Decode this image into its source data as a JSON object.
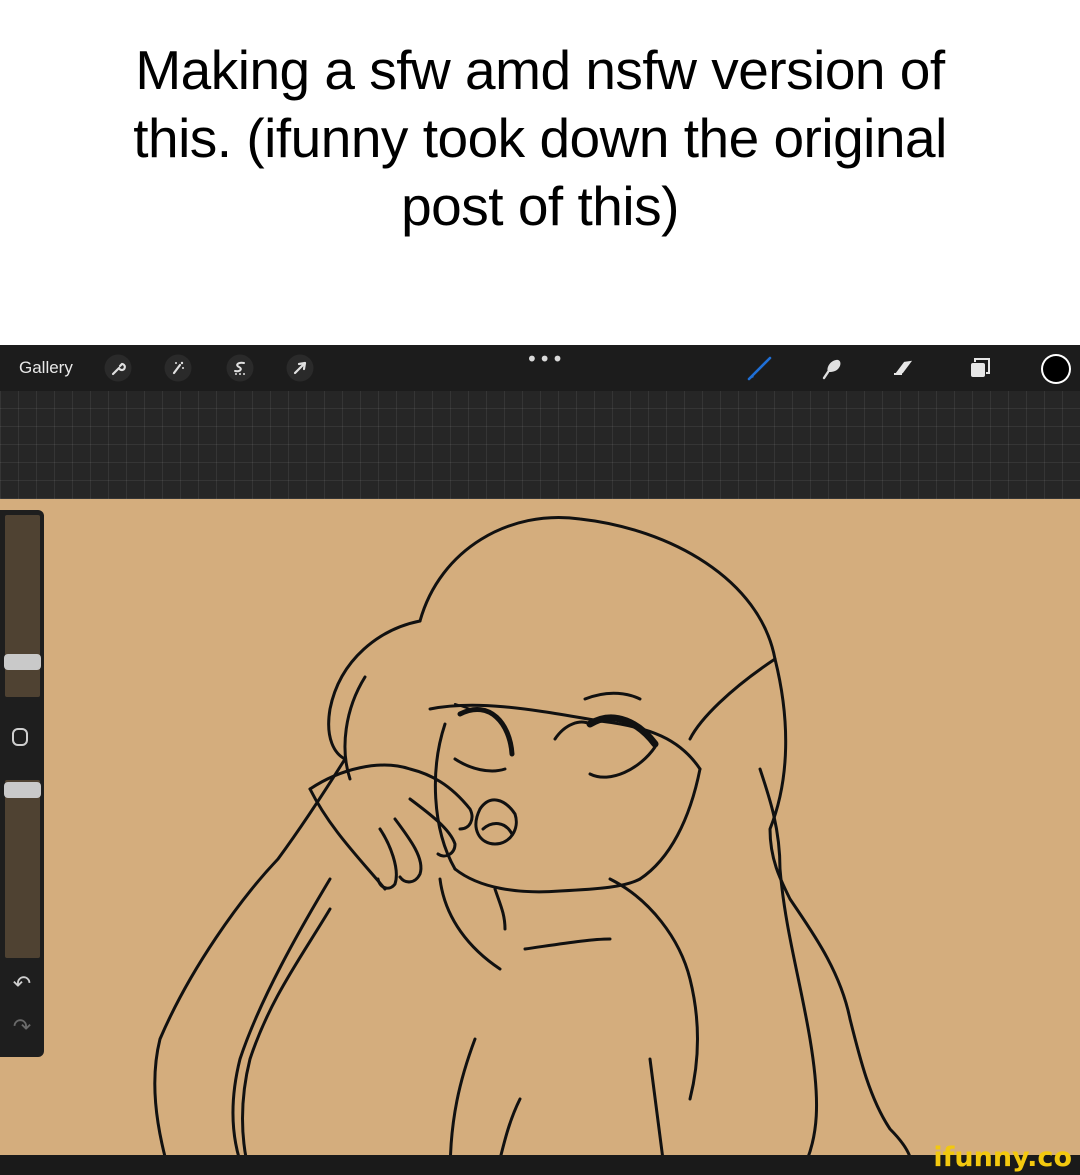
{
  "caption": {
    "line1": "Making a sfw amd nsfw version of",
    "line2": "this. (ifunny took down the original",
    "line3": "post of this)"
  },
  "toolbar": {
    "gallery_label": "Gallery",
    "more_label": "•••",
    "left_icons": [
      "wrench-icon",
      "magic-wand-icon",
      "selection-icon",
      "transform-arrow-icon"
    ],
    "right_icons": [
      "brush-icon",
      "smudge-icon",
      "eraser-icon",
      "layers-icon",
      "color-swatch"
    ],
    "brush_color": "#1f6fd6",
    "current_color": "#000000"
  },
  "sidebar": {
    "modify_icon": "square-modify-icon",
    "undo_label": "↶",
    "redo_label": "↷"
  },
  "canvas": {
    "background": "#d4ad7d",
    "line_color": "#111111"
  },
  "watermark": {
    "label": "ifunny.co",
    "color": "#f2c80f"
  }
}
